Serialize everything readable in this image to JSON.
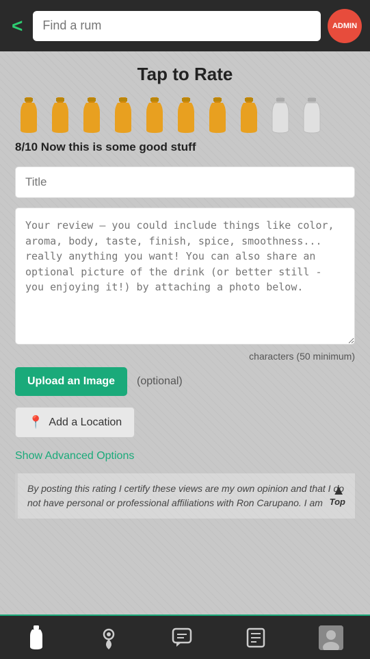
{
  "header": {
    "back_label": "<",
    "search_placeholder": "Find a rum",
    "admin_label": "ADMIN"
  },
  "rating": {
    "title": "Tap to Rate",
    "score": 8,
    "total": 10,
    "label": "8/10 Now this is some good stuff",
    "filled_bottles": 8,
    "empty_bottles": 2
  },
  "form": {
    "title_placeholder": "Title",
    "review_placeholder": "Your review – you could include things like color, aroma, body, taste, finish, spice, smoothness... really anything you want! You can also share an optional picture of the drink (or better still - you enjoying it!) by attaching a photo below.",
    "chars_info": "characters (50 minimum)",
    "upload_label": "Upload an Image",
    "optional_label": "(optional)",
    "location_label": "Add a Location",
    "advanced_label": "Show Advanced Options"
  },
  "disclaimer": {
    "text": "By posting this rating I certify these views are my own opinion and that I do not have personal or professional affiliations with Ron Carupano. I am",
    "top_label": "Top"
  },
  "bottom_nav": {
    "items": [
      {
        "name": "bottle",
        "icon": "🍾",
        "active": true
      },
      {
        "name": "location",
        "icon": "📍",
        "active": false
      },
      {
        "name": "chat",
        "icon": "💬",
        "active": false
      },
      {
        "name": "list",
        "icon": "📋",
        "active": false
      }
    ]
  }
}
